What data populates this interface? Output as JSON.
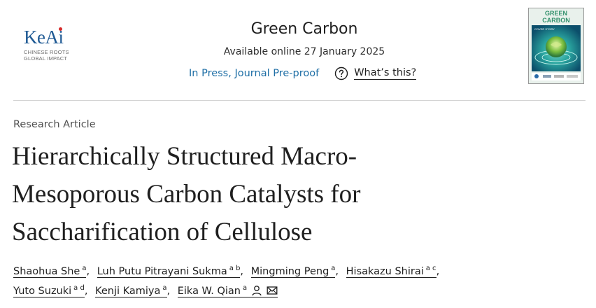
{
  "header": {
    "publisher_logo": {
      "word": "KeAi",
      "tagline": [
        "CHINESE ROOTS",
        "GLOBAL IMPACT"
      ]
    },
    "journal_title": "Green Carbon",
    "availability": "Available online 27 January 2025",
    "status_link": "In Press, Journal Pre-proof",
    "help_text": "What’s this?",
    "cover": {
      "title_line1": "GREEN",
      "title_line2": "CARBON",
      "label": "COVER STORY"
    }
  },
  "article": {
    "type": "Research Article",
    "title_lines": [
      "Hierarchically Structured Macro-",
      "Mesoporous Carbon Catalysts for",
      "Saccharification of Cellulose"
    ],
    "authors": [
      {
        "name": "Shaohua She",
        "aff": "a",
        "sep": ","
      },
      {
        "name": "Luh Putu Pitrayani Sukma",
        "aff": "a b",
        "sep": ","
      },
      {
        "name": "Mingming Peng",
        "aff": "a",
        "sep": ","
      },
      {
        "name": "Hisakazu Shirai",
        "aff": "a c",
        "sep": ","
      },
      {
        "name": "Yuto Suzuki",
        "aff": "a d",
        "sep": ","
      },
      {
        "name": "Kenji Kamiya",
        "aff": "a",
        "sep": ","
      },
      {
        "name": "Eika W. Qian",
        "aff": "a",
        "sep": ""
      }
    ],
    "corresponding_icons": [
      "person-icon",
      "envelope-icon"
    ]
  },
  "colors": {
    "link": "#1f6fa6",
    "logo_blue": "#1f5a94",
    "logo_dot": "#d62a2a",
    "cover_teal": "#2aa6a0"
  }
}
